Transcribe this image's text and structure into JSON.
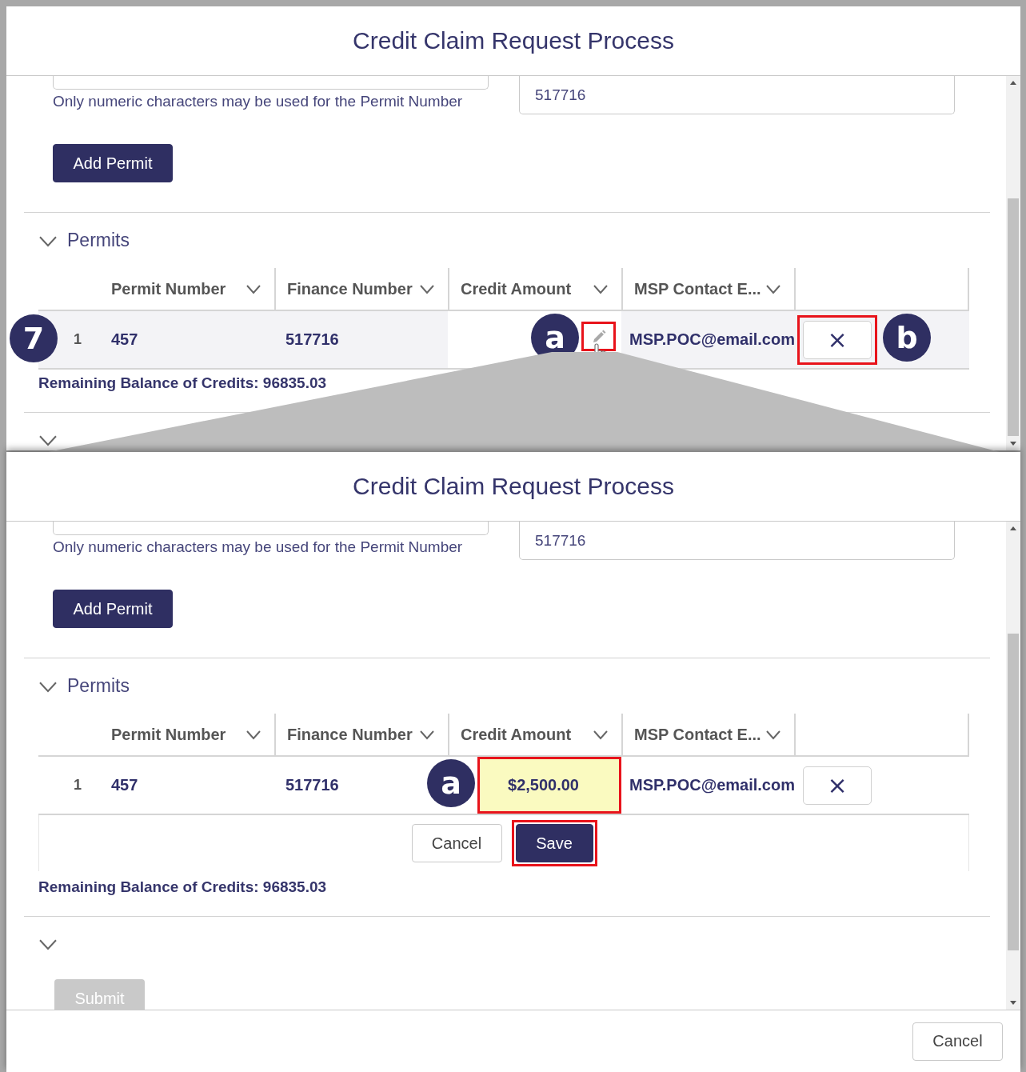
{
  "panels": [
    {
      "title": "Credit Claim Request Process",
      "permit_hint": "Only numeric characters may be used for the Permit Number",
      "finance_value": "517716",
      "add_button": "Add Permit",
      "section": {
        "title": "Permits",
        "expanded": true
      },
      "columns": [
        "Permit Number",
        "Finance Number",
        "Credit Amount",
        "MSP Contact E..."
      ],
      "rows": [
        {
          "row_marker": "7",
          "index": "1",
          "permit": "457",
          "finance": "517716",
          "credit_marker": "a",
          "email": "MSP.POC@email.com",
          "delete": "×",
          "delete_marker": "b",
          "hovered": true,
          "editing": false,
          "edit_highlighted": true,
          "delete_highlighted": true
        }
      ],
      "balance": "Remaining Balance of Credits: 96835.03"
    },
    {
      "title": "Credit Claim Request Process",
      "permit_hint": "Only numeric characters may be used for the Permit Number",
      "finance_value": "517716",
      "add_button": "Add Permit",
      "section": {
        "title": "Permits",
        "expanded": true
      },
      "columns": [
        "Permit Number",
        "Finance Number",
        "Credit Amount",
        "MSP Contact E..."
      ],
      "rows": [
        {
          "index": "1",
          "permit": "457",
          "finance": "517716",
          "credit_marker": "a",
          "credit_amount": "$2,500.00",
          "email": "MSP.POC@email.com",
          "delete": "×",
          "hovered": false,
          "editing": true,
          "credit_highlighted": true,
          "delete_highlighted": false
        }
      ],
      "inline_edit": [
        {
          "label": "Cancel",
          "kind": "neutral",
          "highlighted": false
        },
        {
          "label": "Save",
          "kind": "brand",
          "highlighted": true
        }
      ],
      "balance": "Remaining Balance of Credits: 96835.03",
      "submit": {
        "label": "Submit",
        "disabled": true
      },
      "footer_buttons": [
        "Cancel"
      ]
    }
  ]
}
